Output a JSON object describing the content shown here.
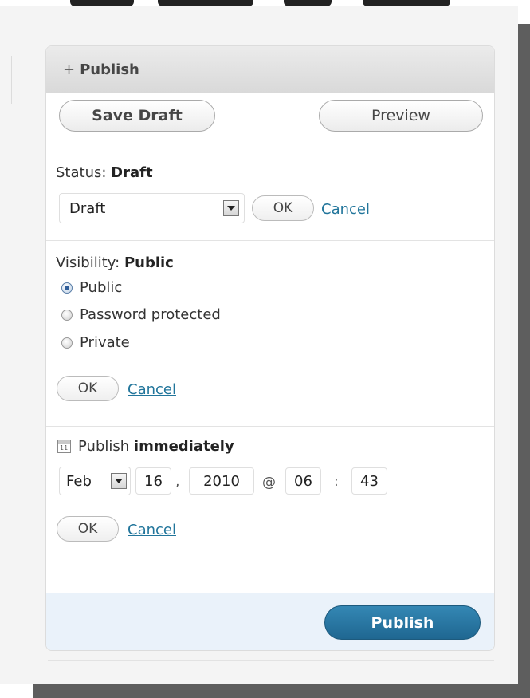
{
  "header": {
    "toggle_symbol": "+",
    "title": "Publish"
  },
  "actions": {
    "save_draft": "Save Draft",
    "preview": "Preview"
  },
  "status": {
    "label": "Status:",
    "value": "Draft",
    "select_value": "Draft",
    "ok": "OK",
    "cancel": "Cancel"
  },
  "visibility": {
    "label": "Visibility:",
    "value": "Public",
    "options": [
      {
        "label": "Public",
        "checked": true
      },
      {
        "label": "Password protected",
        "checked": false
      },
      {
        "label": "Private",
        "checked": false
      }
    ],
    "ok": "OK",
    "cancel": "Cancel"
  },
  "schedule": {
    "icon": "calendar-icon",
    "icon_day": "11",
    "label": "Publish",
    "value": "immediately",
    "month": "Feb",
    "day": "16",
    "comma": ",",
    "year": "2010",
    "at": "@",
    "hour": "06",
    "colon": ":",
    "minute": "43",
    "ok": "OK",
    "cancel": "Cancel"
  },
  "footer": {
    "publish": "Publish"
  },
  "colors": {
    "link": "#21759b",
    "publish_button": "#21759b",
    "footer_bg": "#eaf2fa"
  }
}
